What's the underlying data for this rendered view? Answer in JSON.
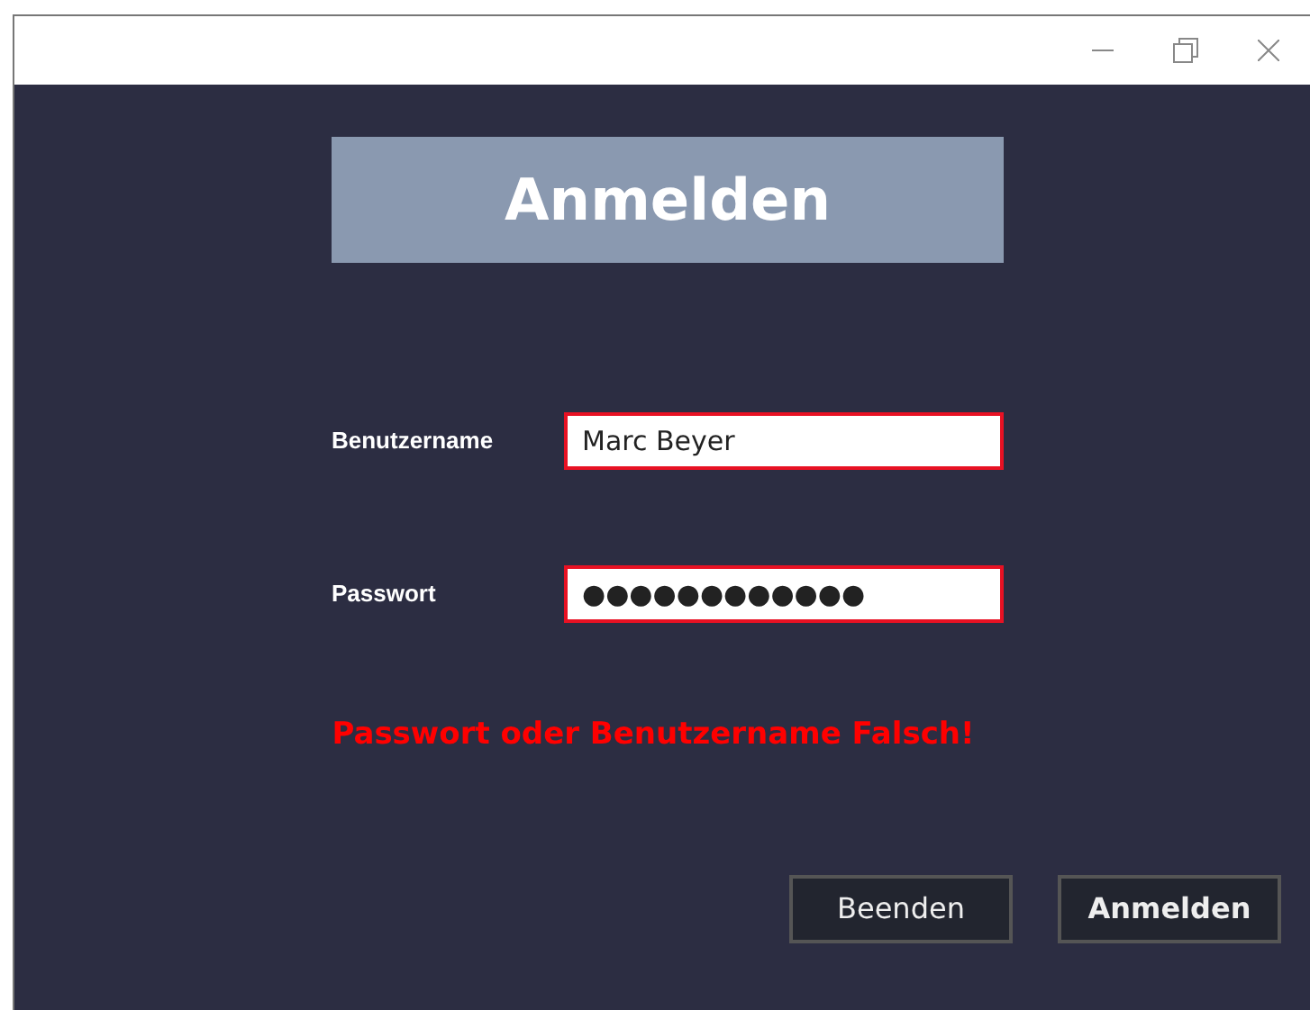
{
  "window": {
    "controls": [
      {
        "kind": "minimize"
      },
      {
        "kind": "restore"
      },
      {
        "kind": "close"
      }
    ]
  },
  "header": {
    "title": "Anmelden"
  },
  "fields": [
    {
      "label": "Benutzername",
      "value": "Marc Beyer",
      "invalid": true
    },
    {
      "label": "Passwort",
      "value": "●●●●●●●●●●●●",
      "invalid": true
    }
  ],
  "error": "Passwort oder Benutzername Falsch!",
  "buttons": [
    {
      "label": "Beenden",
      "primary": false
    },
    {
      "label": "Anmelden",
      "primary": true
    }
  ]
}
